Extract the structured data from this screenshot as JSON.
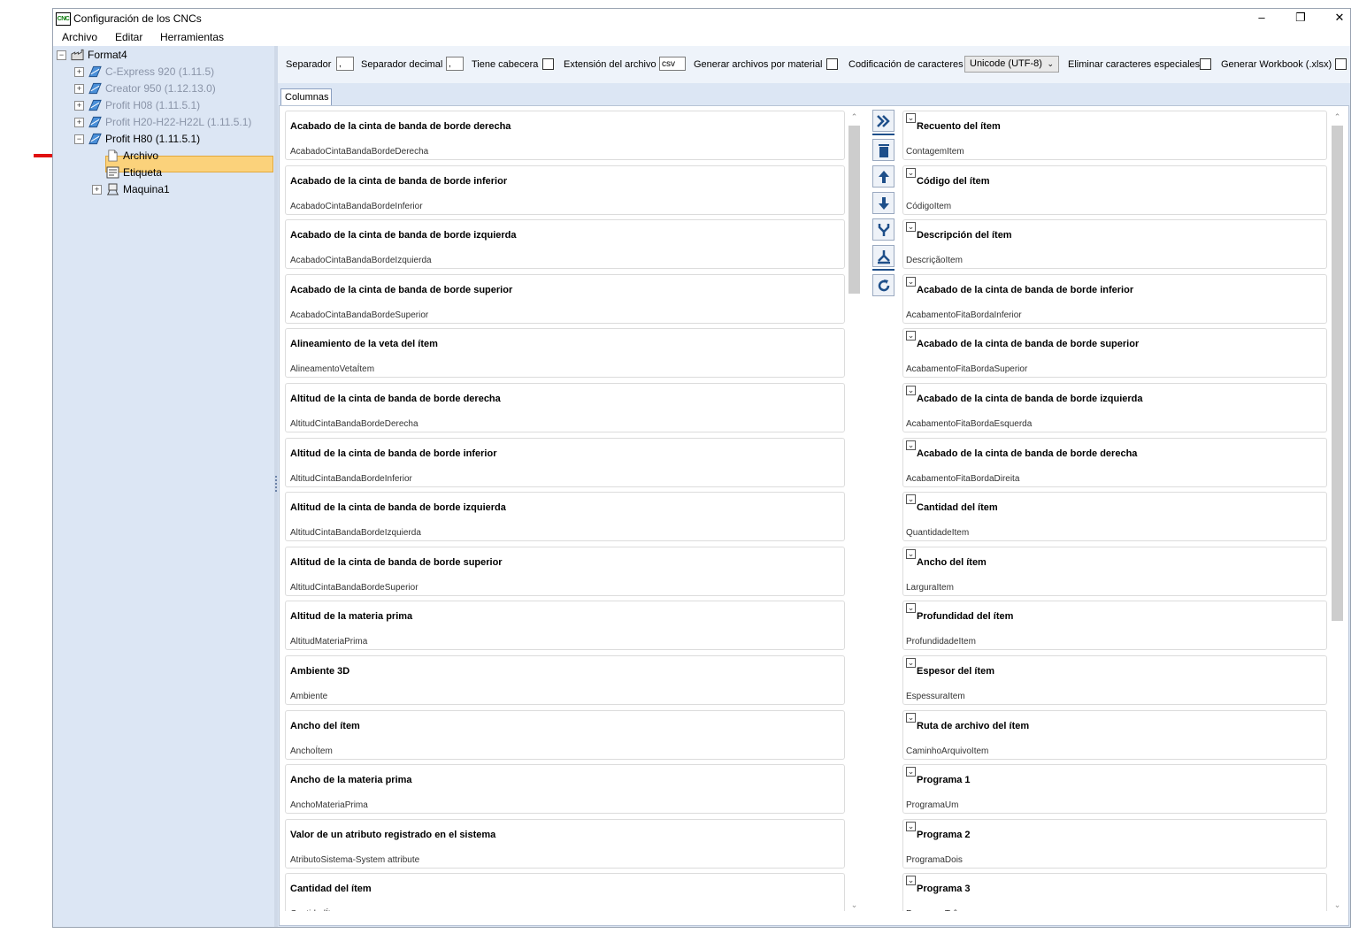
{
  "window": {
    "title": "Configuración de los CNCs",
    "icon_text": "CNC",
    "minimize": "–",
    "restore": "❐",
    "close": "✕"
  },
  "menu": [
    "Archivo",
    "Editar",
    "Herramientas"
  ],
  "tree": {
    "root": "Format4",
    "machines": [
      {
        "label": "C-Express 920 (1.11.5)"
      },
      {
        "label": "Creator 950 (1.12.13.0)"
      },
      {
        "label": "Profit H08 (1.11.5.1)"
      },
      {
        "label": "Profit H20-H22-H22L (1.11.5.1)"
      },
      {
        "label": "Profit H80 (1.11.5.1)"
      }
    ],
    "children": [
      {
        "label": "Archivo"
      },
      {
        "label": "Etiqueta"
      },
      {
        "label": "Maquina1"
      }
    ]
  },
  "toolbar": {
    "separator_label": "Separador",
    "separator_value": ",",
    "decimal_label": "Separador decimal",
    "decimal_value": ",",
    "header_label": "Tiene cabecera",
    "extension_label": "Extensión del archivo",
    "extension_value": "csv",
    "per_material_label": "Generar archivos por material",
    "encoding_label": "Codificación de caracteres",
    "encoding_value": "Unicode (UTF-8)",
    "remove_special_label": "Eliminar caracteres especiales",
    "workbook_label": "Generar Workbook (.xlsx)"
  },
  "tabs": [
    "Columnas"
  ],
  "available_columns": [
    {
      "title": "Acabado de la cinta de banda de borde derecha",
      "field": "AcabadoCintaBandaBordeDerecha"
    },
    {
      "title": "Acabado de la cinta de banda de borde inferior",
      "field": "AcabadoCintaBandaBordeInferior"
    },
    {
      "title": "Acabado de la cinta de banda de borde izquierda",
      "field": "AcabadoCintaBandaBordeIzquierda"
    },
    {
      "title": "Acabado de la cinta de banda de borde superior",
      "field": "AcabadoCintaBandaBordeSuperior"
    },
    {
      "title": "Alineamiento de la veta del ítem",
      "field": "AlineamentoVetaÍtem"
    },
    {
      "title": "Altitud de la cinta de banda de borde derecha",
      "field": "AltitudCintaBandaBordeDerecha"
    },
    {
      "title": "Altitud de la cinta de banda de borde inferior",
      "field": "AltitudCintaBandaBordeInferior"
    },
    {
      "title": "Altitud de la cinta de banda de borde izquierda",
      "field": "AltitudCintaBandaBordeIzquierda"
    },
    {
      "title": "Altitud de la cinta de banda de borde superior",
      "field": "AltitudCintaBandaBordeSuperior"
    },
    {
      "title": "Altitud de la materia prima",
      "field": "AltitudMateriaPrima"
    },
    {
      "title": "Ambiente 3D",
      "field": "Ambiente"
    },
    {
      "title": "Ancho del ítem",
      "field": "AnchoÍtem"
    },
    {
      "title": "Ancho de la materia prima",
      "field": "AnchoMateriaPrima"
    },
    {
      "title": "Valor de un atributo registrado en el sistema",
      "field": "AtributoSistema-System attribute"
    },
    {
      "title": "Cantidad del ítem",
      "field": "CantidadÍtem"
    }
  ],
  "selected_columns": [
    {
      "title": "Recuento del ítem",
      "field": "ContagemItem"
    },
    {
      "title": "Código del ítem",
      "field": "CódigoItem"
    },
    {
      "title": "Descripción del ítem",
      "field": "DescriçãoItem"
    },
    {
      "title": "Acabado de la cinta de banda de borde inferior",
      "field": "AcabamentoFitaBordaInferior"
    },
    {
      "title": "Acabado de la cinta de banda de borde superior",
      "field": "AcabamentoFitaBordaSuperior"
    },
    {
      "title": "Acabado de la cinta de banda de borde izquierda",
      "field": "AcabamentoFitaBordaEsquerda"
    },
    {
      "title": "Acabado de la cinta de banda de borde derecha",
      "field": "AcabamentoFitaBordaDireita"
    },
    {
      "title": "Cantidad del ítem",
      "field": "QuantidadeItem"
    },
    {
      "title": "Ancho del ítem",
      "field": "LarguraItem"
    },
    {
      "title": "Profundidad del ítem",
      "field": "ProfundidadeItem"
    },
    {
      "title": "Espesor del ítem",
      "field": "EspessuraItem"
    },
    {
      "title": "Ruta de archivo del ítem",
      "field": "CaminhoArquivoItem"
    },
    {
      "title": "Programa 1",
      "field": "ProgramaUm"
    },
    {
      "title": "Programa 2",
      "field": "ProgramaDois"
    },
    {
      "title": "Programa 3",
      "field": "ProgramaTrês"
    }
  ],
  "mid_buttons": [
    "add-all-icon",
    "delete-icon",
    "move-up-icon",
    "move-down-icon",
    "merge-icon",
    "split-icon",
    "refresh-icon"
  ],
  "colors": {
    "tree_bg": "#dce6f4",
    "selection": "#fbd27b",
    "accent": "#1e4f8a",
    "annotation_arrow": "#e01010"
  }
}
